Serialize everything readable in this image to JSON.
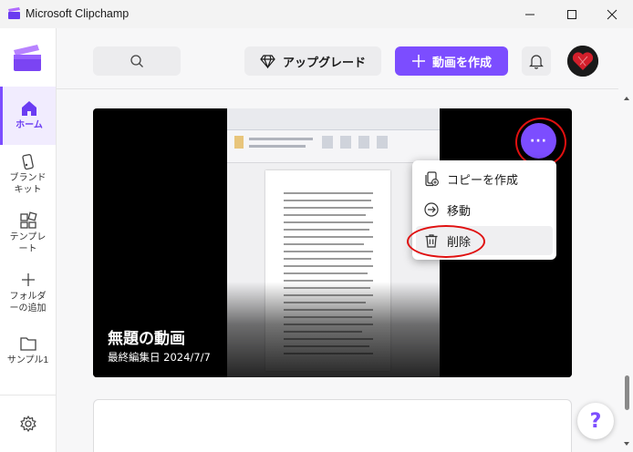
{
  "window": {
    "title": "Microsoft Clipchamp"
  },
  "sidebar": {
    "items": [
      {
        "id": "home",
        "label": "ホーム",
        "icon": "home-icon"
      },
      {
        "id": "brand-kit",
        "label": "ブランド\nキット",
        "icon": "brand-kit-icon"
      },
      {
        "id": "templates",
        "label": "テンプレ\nート",
        "icon": "templates-icon"
      },
      {
        "id": "add-folder",
        "label": "フォルダ\nーの追加",
        "icon": "plus-icon"
      },
      {
        "id": "sample",
        "label": "サンプル1",
        "icon": "folder-icon"
      }
    ],
    "settings_icon": "gear-icon"
  },
  "header": {
    "search_icon": "search-icon",
    "upgrade_label": "アップグレード",
    "upgrade_icon": "diamond-icon",
    "create_label": "動画を作成",
    "create_icon": "plus-icon",
    "bell_icon": "bell-icon"
  },
  "video_card": {
    "title": "無題の動画",
    "date": "最終編集日 2024/7/7",
    "more_label": "···"
  },
  "context_menu": {
    "items": [
      {
        "label": "コピーを作成",
        "icon": "copy-icon"
      },
      {
        "label": "移動",
        "icon": "move-icon"
      },
      {
        "label": "削除",
        "icon": "trash-icon"
      }
    ]
  },
  "help": {
    "label": "?"
  },
  "colors": {
    "accent": "#7c4dff",
    "annotation": "#e01010"
  }
}
